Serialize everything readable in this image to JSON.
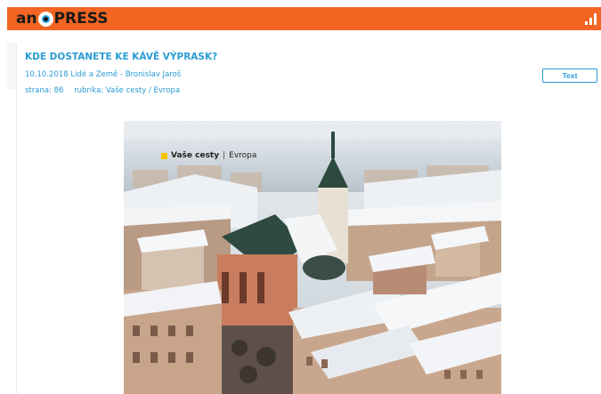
{
  "brand": {
    "logo_left": "an",
    "logo_right": "PRESS",
    "icon": "signal-bars-icon",
    "accent": "#f26522"
  },
  "article": {
    "title": "KDE DOSTANETE KE KÁVĚ VÝPRASK?",
    "meta": "10.10.2018 Lidé a Země - Bronislav Jaroš",
    "page": "strana: 86",
    "section": "rubrika: Vaše cesty / Evropa",
    "text_button": "Text",
    "link_color": "#2a9bd4"
  },
  "image_caption": {
    "strong": "Vaše cesty",
    "separator": "|",
    "rest": "Evropa"
  }
}
